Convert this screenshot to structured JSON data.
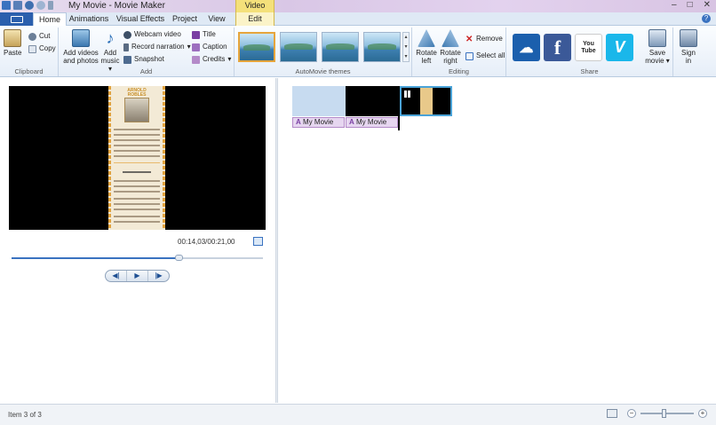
{
  "window": {
    "title": "My Movie - Movie Maker",
    "context_tab_group": "Video Tools",
    "controls": [
      "–",
      "□",
      "✕"
    ]
  },
  "tabs": [
    {
      "label": "Home",
      "active": true
    },
    {
      "label": "Animations",
      "active": false
    },
    {
      "label": "Visual Effects",
      "active": false
    },
    {
      "label": "Project",
      "active": false
    },
    {
      "label": "View",
      "active": false
    },
    {
      "label": "Edit",
      "active": false
    }
  ],
  "ribbon": {
    "clipboard": {
      "label": "Clipboard",
      "paste": "Paste",
      "cut": "Cut",
      "copy": "Copy"
    },
    "add": {
      "label": "Add",
      "add_videos_1": "Add videos",
      "add_videos_2": "and photos",
      "add_music_1": "Add",
      "add_music_2": "music",
      "webcam": "Webcam video",
      "narration": "Record narration",
      "snapshot": "Snapshot",
      "title": "Title",
      "caption": "Caption",
      "credits": "Credits"
    },
    "themes": {
      "label": "AutoMovie themes",
      "count": 4,
      "selected_index": 0
    },
    "editing": {
      "label": "Editing",
      "rotate_left_1": "Rotate",
      "rotate_left_2": "left",
      "rotate_right_1": "Rotate",
      "rotate_right_2": "right",
      "remove": "Remove",
      "select_all": "Select all"
    },
    "share": {
      "label": "Share",
      "services": [
        {
          "name": "onedrive",
          "color": "#1b5fad",
          "glyph": "☁"
        },
        {
          "name": "facebook",
          "color": "#3b5998",
          "glyph": "f"
        },
        {
          "name": "youtube",
          "color": "#ffffff",
          "glyph": "You Tube"
        },
        {
          "name": "vimeo",
          "color": "#1ab7ea",
          "glyph": "V"
        }
      ],
      "save_movie_1": "Save",
      "save_movie_2": "movie",
      "sign_in_1": "Sign",
      "sign_in_2": "in"
    }
  },
  "preview": {
    "poster_title_1": "ARNOLD",
    "poster_title_2": "ROBLES",
    "timecode": "00:14,03/00:21,00",
    "progress": 0.665,
    "controls": {
      "prev": "◀|",
      "play": "▶",
      "next": "|▶"
    }
  },
  "storyboard": {
    "captions": [
      "My Movie",
      "My Movie"
    ],
    "caption_glyph": "A"
  },
  "status": {
    "text": "Item 3 of 3",
    "zoom_out": "−",
    "zoom_in": "+"
  },
  "colors": {
    "accent": "#2b5fad",
    "context_tab": "#f4e07a",
    "caption_bg": "#e6d6f0",
    "selection": "#4aa3d8"
  }
}
